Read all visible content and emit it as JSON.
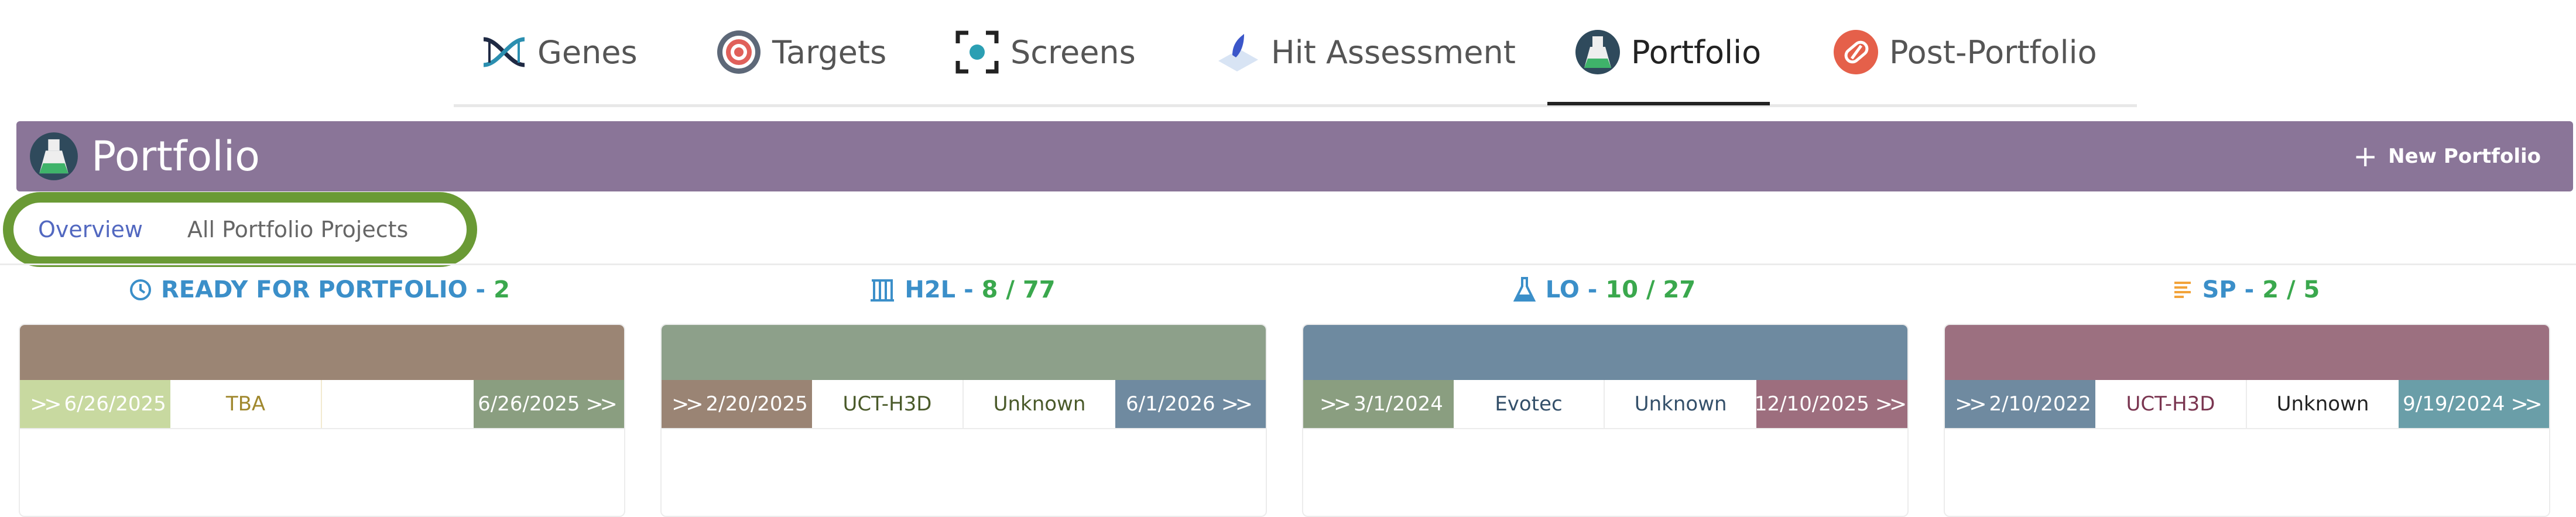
{
  "nav": {
    "items": [
      {
        "label": "Genes",
        "icon": "dna-icon"
      },
      {
        "label": "Targets",
        "icon": "target-icon"
      },
      {
        "label": "Screens",
        "icon": "screen-icon"
      },
      {
        "label": "Hit Assessment",
        "icon": "hit-assessment-icon"
      },
      {
        "label": "Portfolio",
        "icon": "portfolio-icon",
        "active": true
      },
      {
        "label": "Post-Portfolio",
        "icon": "post-portfolio-icon"
      }
    ]
  },
  "header": {
    "title": "Portfolio",
    "new_button": "New Portfolio",
    "color": "#8a7598"
  },
  "subtabs": {
    "overview": "Overview",
    "all": "All Portfolio Projects",
    "highlight_color": "#6a9a35"
  },
  "columns": [
    {
      "label": "READY FOR PORTFOLIO -",
      "count": "2",
      "label_color": "#3b8fc9",
      "icon": "clock-icon",
      "band_color": "#9b8574",
      "start_date": "6/26/2025",
      "start_color": "#c8d9a0",
      "mid1": "TBA",
      "mid2": "",
      "end_date": "6/26/2025",
      "end_color": "#8a9e80",
      "mid_text_color": "#a0882e"
    },
    {
      "label": "H2L -",
      "count": "8 / 77",
      "label_color": "#3b8fc9",
      "icon": "h2l-icon",
      "band_color": "#8da08a",
      "start_date": "2/20/2025",
      "start_color": "#9a8474",
      "mid1": "UCT-H3D",
      "mid2": "Unknown",
      "end_date": "6/1/2026",
      "end_color": "#6f8aa0",
      "mid_text_color": "#5a6a2a"
    },
    {
      "label": "LO -",
      "count": "10 / 27",
      "label_color": "#3b8fc9",
      "icon": "flask-icon",
      "band_color": "#6e8aa0",
      "start_date": "3/1/2024",
      "start_color": "#8a9e80",
      "mid1": "Evotec",
      "mid2": "Unknown",
      "end_date": "12/10/2025",
      "end_color": "#9d6e7e",
      "mid_text_color": "#34506a"
    },
    {
      "label": "SP -",
      "count": "2 / 5",
      "label_color": "#3b8fc9",
      "icon": "sp-icon",
      "band_color": "#9c7080",
      "start_date": "2/10/2022",
      "start_color": "#6f8aa0",
      "mid1": "UCT-H3D",
      "mid2": "Unknown",
      "end_date": "9/19/2024",
      "end_color": "#6a9ea8",
      "mid_text_color": "#7a3550"
    }
  ]
}
